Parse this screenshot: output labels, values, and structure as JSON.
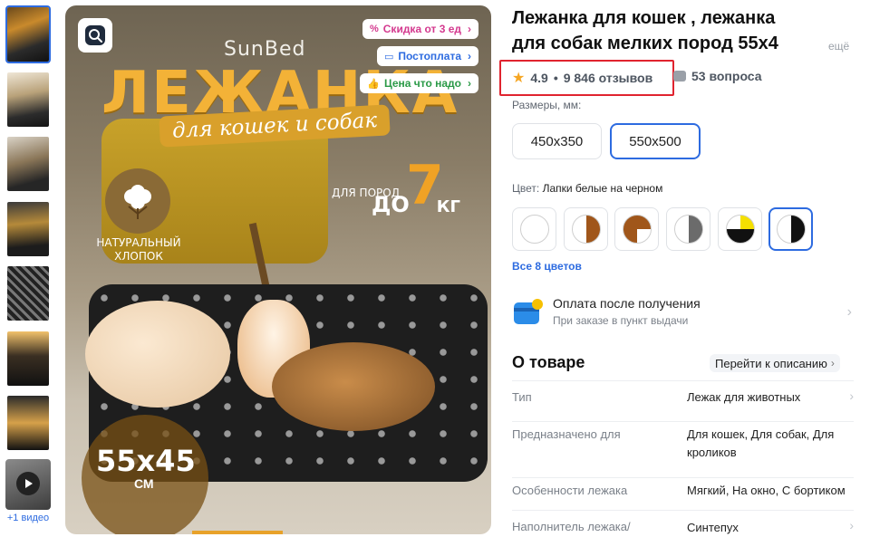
{
  "thumbnails": {
    "count": 7,
    "video_label": "+1 видео"
  },
  "main_image": {
    "brand": "SunBed",
    "headline": "ЛЕЖАНКА",
    "subheadline": "для кошек и собак",
    "cotton_label_line1": "НАТУРАЛЬНЫЙ",
    "cotton_label_line2": "ХЛОПОК",
    "weight_prefix": "ДЛЯ ПОРОД",
    "weight_to": "ДО",
    "weight_number": "7",
    "weight_unit": "КГ",
    "size_text": "55х45",
    "size_unit": "СМ"
  },
  "promos": [
    {
      "icon": "percent-icon",
      "label": "Скидка от 3 ед",
      "color": "#d43a8f"
    },
    {
      "icon": "card-icon",
      "label": "Постоплата",
      "color": "#2d6be0"
    },
    {
      "icon": "thumb-up-icon",
      "label": "Цена что надо",
      "color": "#2b9a47"
    }
  ],
  "product": {
    "title_line1": "Лежанка для кошек , лежанка",
    "title_line2": "для собак мелких пород 55х4",
    "more_label": "ещё",
    "rating": "4.9",
    "reviews": "9 846 отзывов",
    "questions": "53 вопроса",
    "sizes_label": "Размеры, мм:",
    "sizes": [
      "450х350",
      "550х500"
    ],
    "selected_size": "550х500",
    "color_label": "Цвет:",
    "color_value": "Лапки белые на черном",
    "swatches": [
      {
        "name": "white",
        "colors": [
          "#ffffff",
          "#ffffff"
        ]
      },
      {
        "name": "brown-white",
        "colors": [
          "#ffffff",
          "#a0561a"
        ]
      },
      {
        "name": "brown-white-quarter",
        "colors": [
          "#ffffff",
          "#a0561a"
        ]
      },
      {
        "name": "grey-white",
        "colors": [
          "#ffffff",
          "#6b6b6b"
        ]
      },
      {
        "name": "black-yellow",
        "colors": [
          "#111111",
          "#f5e000"
        ]
      },
      {
        "name": "black-white",
        "colors": [
          "#ffffff",
          "#111111"
        ]
      }
    ],
    "all_colors_label": "Все 8 цветов",
    "payment_title": "Оплата после получения",
    "payment_sub": "При заказе в пункт выдачи",
    "about_label": "О товаре",
    "goto_label": "Перейти к описанию",
    "specs": [
      {
        "key": "Тип",
        "value": "Лежак для животных"
      },
      {
        "key": "Предназначено для",
        "value": "Для кошек, Для собак, Для кроликов"
      },
      {
        "key": "Особенности лежака",
        "value": "Мягкий, На окно, С бортиком"
      },
      {
        "key": "Наполнитель лежака/",
        "value": "Синтепух"
      }
    ]
  },
  "colors": {
    "accent": "#2d6be0",
    "highlight": "#e0242f",
    "star": "#f6a623"
  }
}
